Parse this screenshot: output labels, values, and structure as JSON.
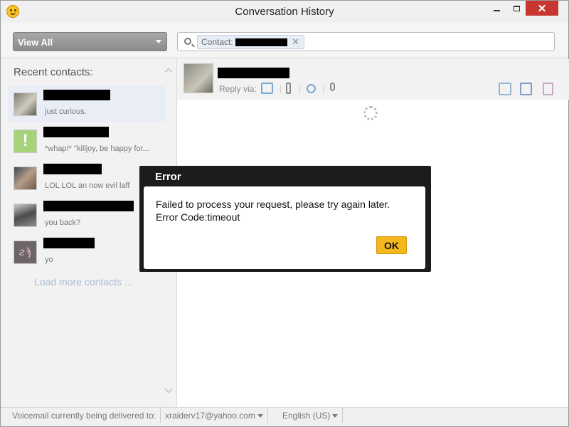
{
  "window": {
    "title": "Conversation History"
  },
  "toolbar": {
    "filter_value": "View All",
    "search_token_label": "Contact:"
  },
  "left": {
    "heading": "Recent contacts:",
    "contacts": [
      {
        "snippet": "just curious.",
        "avatar": "photo"
      },
      {
        "snippet": "*whap!* \"killjoy, be happy for...",
        "avatar": "exclamation"
      },
      {
        "snippet": "LOL LOL an now evil laff",
        "avatar": "photo"
      },
      {
        "snippet": "you back?",
        "avatar": "photo"
      },
      {
        "snippet": "yo",
        "avatar": "drawing"
      }
    ],
    "load_more": "Load more contacts ..."
  },
  "right": {
    "reply_via": "Reply via:",
    "reply_icons": [
      "chat-icon",
      "phone-icon",
      "webcam-icon",
      "mic-icon"
    ],
    "action_icons": [
      "print-icon",
      "save-icon",
      "delete-icon"
    ]
  },
  "status": {
    "voicemail_label": "Voicemail currently being delivered to:",
    "email": "xraiderv17@yahoo.com",
    "language": "English (US)"
  },
  "modal": {
    "title": "Error",
    "message_line1": "Failed to process your request, please try again later.",
    "message_line2": "Error Code:timeout",
    "ok_label": "OK"
  },
  "colors": {
    "ok_button": "#f4b81c",
    "close_button": "#c7372f",
    "modal_frame": "#1c1c1c",
    "load_more": "#a9bdd6"
  }
}
